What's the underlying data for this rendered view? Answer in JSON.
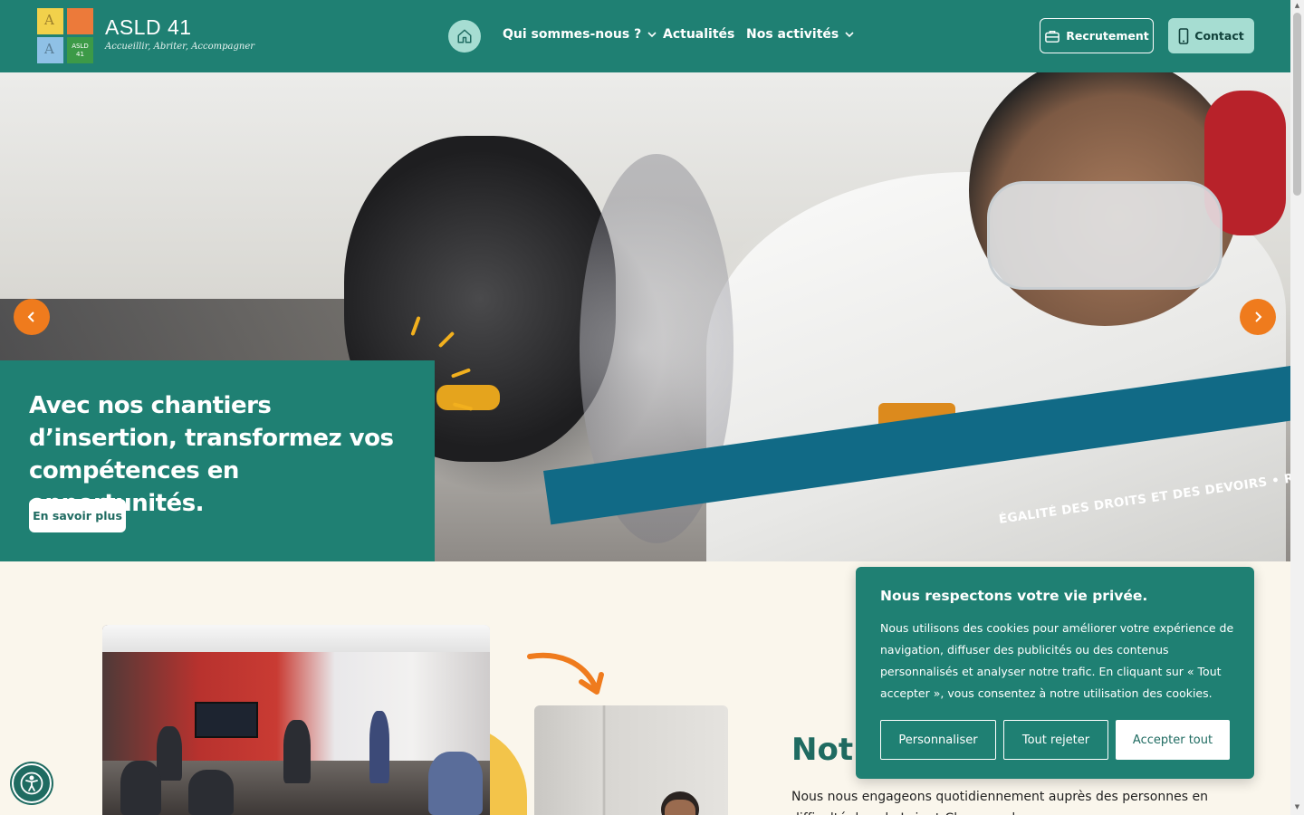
{
  "header": {
    "brand_name": "ASLD 41",
    "brand_tagline": "Accueillir, Abriter, Accompagner",
    "logo_letters": [
      "A",
      "A"
    ],
    "logo_badge": "ASLD 41",
    "nav": [
      {
        "label": "Qui sommes-nous ?",
        "has_dropdown": true
      },
      {
        "label": "Actualités",
        "has_dropdown": false
      },
      {
        "label": "Nos activités",
        "has_dropdown": true
      }
    ],
    "recruit_label": "Recrutement",
    "contact_label": "Contact"
  },
  "hero": {
    "title": "Avec nos chantiers d’insertion, transformez vos compétences en opportunités.",
    "cta_label": "En savoir plus",
    "banner_text": "ÉGALITÉ DES DROITS ET DES DEVOIRS • RESPECT"
  },
  "section": {
    "title": "Notre",
    "text": "Nous nous engageons quotidiennement auprès des personnes en difficulté dans le Loir-et-Cher pour les accompagner"
  },
  "cookie": {
    "title": "Nous respectons votre vie privée.",
    "text": "Nous utilisons des cookies pour améliorer votre expérience de navigation, diffuser des publicités ou des contenus personnalisés et analyser notre trafic. En cliquant sur « Tout accepter », vous consentez à notre utilisation des cookies.",
    "personalize_label": "Personnaliser",
    "reject_label": "Tout rejeter",
    "accept_label": "Accepter tout"
  },
  "colors": {
    "primary": "#1f8073",
    "accent_orange": "#ef7b1d",
    "mint": "#a6ddd2",
    "banner_blue": "#116a86",
    "background": "#faf6ec"
  },
  "icons": [
    "home-icon",
    "chevron-down-icon",
    "briefcase-icon",
    "phone-icon",
    "chevron-left-icon",
    "chevron-right-icon",
    "curved-arrow-icon",
    "accessibility-icon"
  ]
}
